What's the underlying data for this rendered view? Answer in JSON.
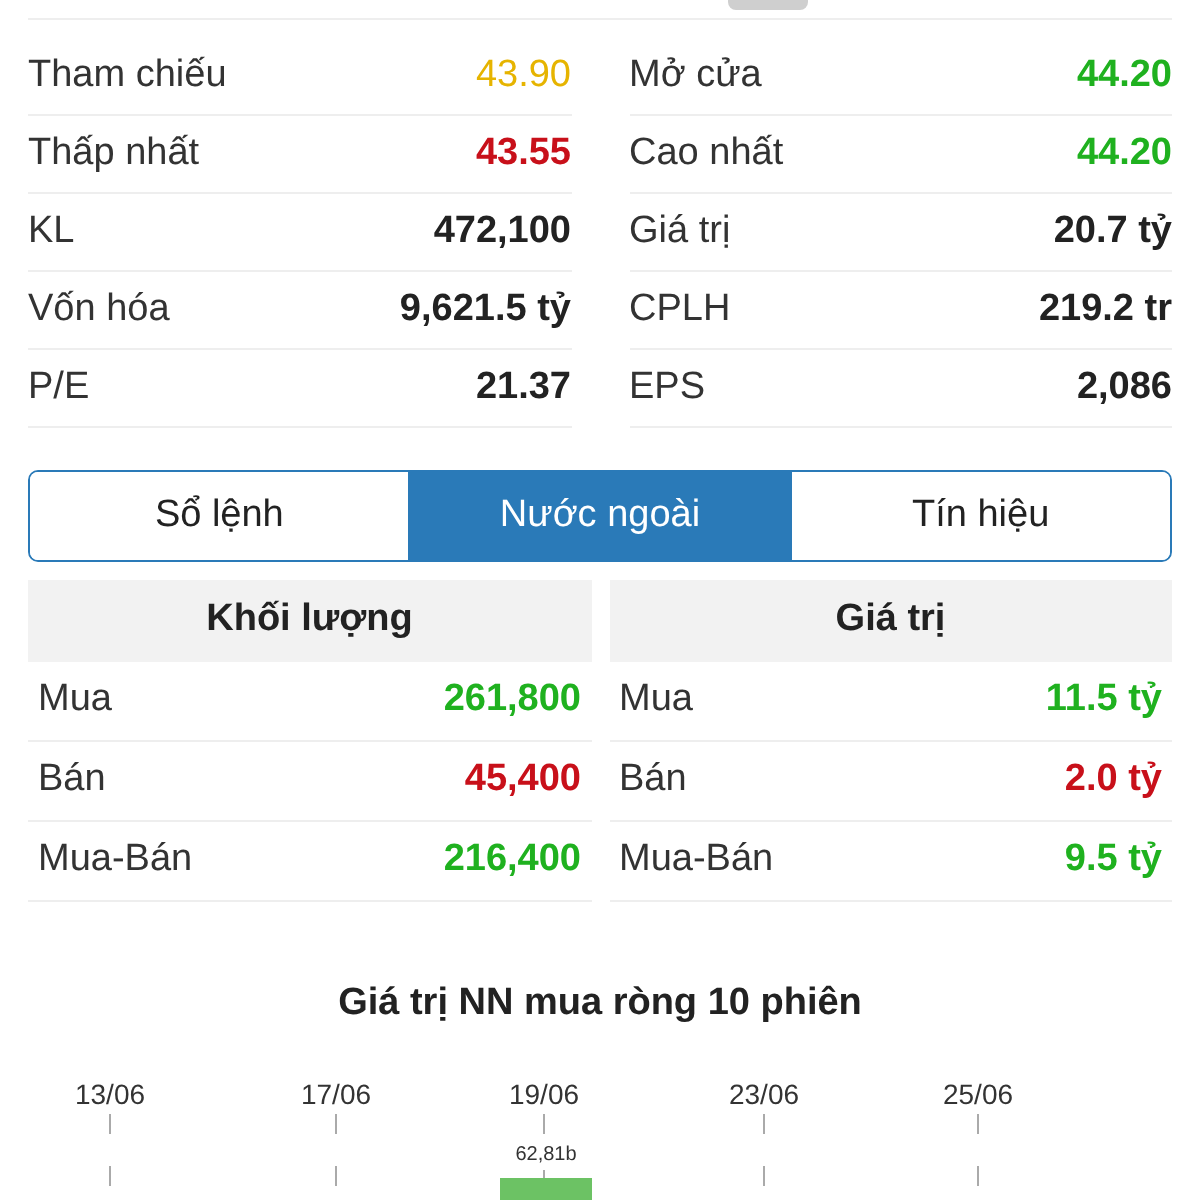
{
  "stats": {
    "left": [
      {
        "label": "Tham chiếu",
        "value": "43.90",
        "color": "#e6b400",
        "bold": false
      },
      {
        "label": "Thấp nhất",
        "value": "43.55",
        "color": "#c8101a",
        "bold": true
      },
      {
        "label": "KL",
        "value": "472,100",
        "color": "#222222",
        "bold": true
      },
      {
        "label": "Vốn hóa",
        "value": "9,621.5 tỷ",
        "color": "#222222",
        "bold": true
      },
      {
        "label": "P/E",
        "value": "21.37",
        "color": "#222222",
        "bold": true
      }
    ],
    "right": [
      {
        "label": "Mở cửa",
        "value": "44.20",
        "color": "#1fb11f",
        "bold": true
      },
      {
        "label": "Cao nhất",
        "value": "44.20",
        "color": "#1fb11f",
        "bold": true
      },
      {
        "label": "Giá trị",
        "value": "20.7 tỷ",
        "color": "#222222",
        "bold": true
      },
      {
        "label": "CPLH",
        "value": "219.2 tr",
        "color": "#222222",
        "bold": true
      },
      {
        "label": "EPS",
        "value": "2,086",
        "color": "#222222",
        "bold": true
      }
    ]
  },
  "tabs": [
    {
      "label": "Sổ lệnh",
      "selected": false
    },
    {
      "label": "Nước ngoài",
      "selected": true
    },
    {
      "label": "Tín hiệu",
      "selected": false
    }
  ],
  "tables": [
    {
      "title": "Khối lượng",
      "rows": [
        {
          "label": "Mua",
          "value": "261,800",
          "color": "#1fb11f"
        },
        {
          "label": "Bán",
          "value": "45,400",
          "color": "#c8101a"
        },
        {
          "label": "Mua-Bán",
          "value": "216,400",
          "color": "#1fb11f"
        }
      ]
    },
    {
      "title": "Giá trị",
      "rows": [
        {
          "label": "Mua",
          "value": "11.5 tỷ",
          "color": "#1fb11f"
        },
        {
          "label": "Bán",
          "value": "2.0 tỷ",
          "color": "#c8101a"
        },
        {
          "label": "Mua-Bán",
          "value": "9.5 tỷ",
          "color": "#1fb11f"
        }
      ]
    }
  ],
  "chart": {
    "title": "Giá trị NN mua ròng 10 phiên",
    "dates": [
      "13/06",
      "17/06",
      "19/06",
      "23/06",
      "25/06"
    ],
    "bar_label": "62,81b"
  }
}
